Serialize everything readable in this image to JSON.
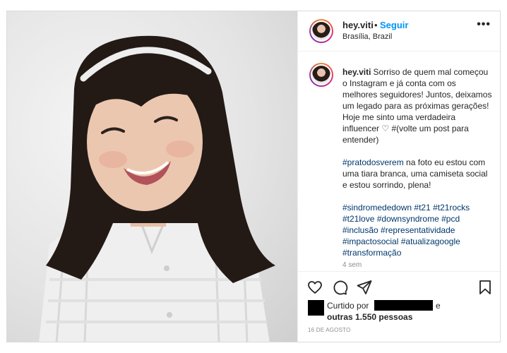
{
  "post": {
    "username": "hey.viti",
    "separator": "•",
    "follow_label": "Seguir",
    "location": "Brasília, Brazil",
    "more_label": "•••",
    "caption": {
      "p1": "Sorriso de quem mal começou o Instagram e já conta com os melhores seguidores! Juntos, deixamos um legado para as próximas gerações! Hoje me sinto uma verdadeira influencer ♡ #(volte um post para entender)",
      "p2_tag": "#pratodosverem",
      "p2_text": " na foto eu estou com uma tiara branca, uma camiseta social e estou sorrindo, plena!",
      "hashtags": [
        "#sindromededown",
        "#t21",
        "#t21rocks",
        "#t21love",
        "#downsyndrome",
        "#pcd",
        "#inclusão",
        "#representatividade",
        "#impactosocial",
        "#atualizagoogle",
        "#transformação"
      ],
      "time_ago": "4 sem"
    },
    "likes": {
      "prefix": "Curtido por",
      "connector": "e",
      "others": "outras 1.550 pessoas"
    },
    "date": "16 DE AGOSTO",
    "icons": [
      "heart-icon",
      "comment-icon",
      "share-icon",
      "save-icon",
      "more-icon"
    ]
  }
}
